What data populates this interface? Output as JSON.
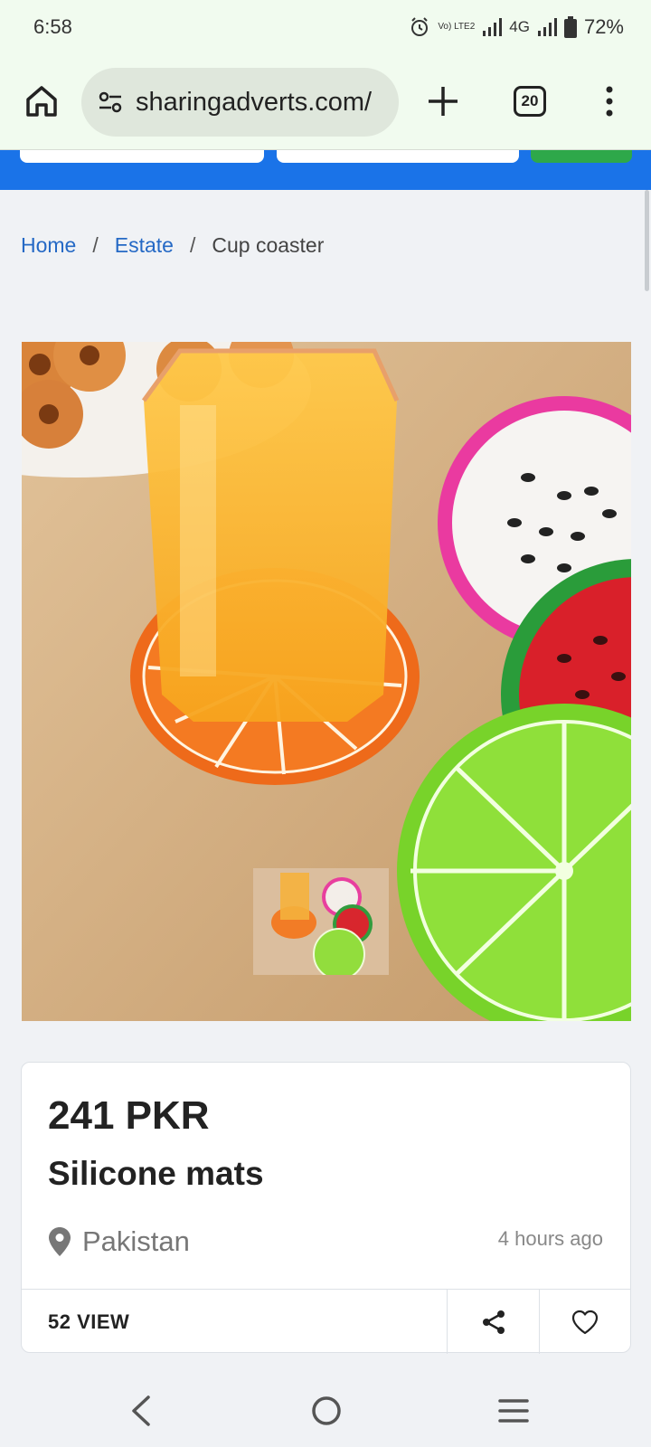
{
  "status_bar": {
    "time": "6:58",
    "network": "4G",
    "volte": "Vo) LTE2",
    "battery": "72%"
  },
  "toolbar": {
    "url": "sharingadverts.com/",
    "tab_count": "20"
  },
  "breadcrumb": {
    "items": [
      "Home",
      "Estate"
    ],
    "current": "Cup coaster",
    "separator": "/"
  },
  "listing": {
    "price": "241 PKR",
    "title": "Silicone mats",
    "location": "Pakistan",
    "posted": "4 hours ago",
    "views": "52 VIEW"
  },
  "colors": {
    "header_blue": "#1a73e8",
    "link_blue": "#2569c5",
    "accent_green": "#2ea84a"
  },
  "icons": {
    "home": "home-icon",
    "site_settings": "tune-icon",
    "new_tab": "plus-icon",
    "tabs": "tab-switcher-icon",
    "menu": "more-vert-icon",
    "location": "location-pin-icon",
    "share": "share-icon",
    "favorite": "heart-icon"
  }
}
